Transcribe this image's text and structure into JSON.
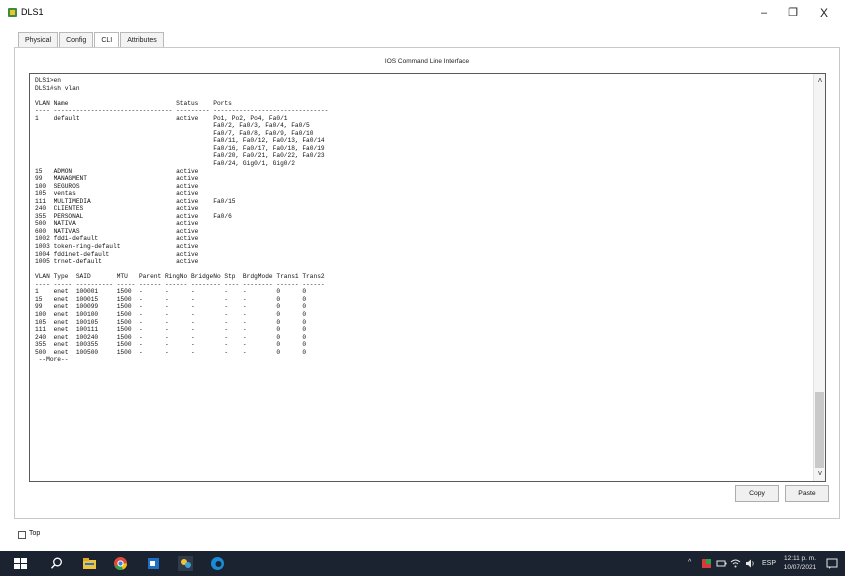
{
  "window": {
    "title": "DLS1",
    "minimize": "–",
    "maximize": "❐",
    "close": "X"
  },
  "tabs": [
    {
      "label": "Physical"
    },
    {
      "label": "Config"
    },
    {
      "label": "CLI"
    },
    {
      "label": "Attributes"
    }
  ],
  "frame_title": "IOS Command Line Interface",
  "terminal_text": "DLS1>en\nDLS1#sh vlan\n\nVLAN Name                             Status    Ports\n---- -------------------------------- --------- -------------------------------\n1    default                          active    Po1, Po2, Po4, Fa0/1\n                                                Fa0/2, Fa0/3, Fa0/4, Fa0/5\n                                                Fa0/7, Fa0/8, Fa0/9, Fa0/10\n                                                Fa0/11, Fa0/12, Fa0/13, Fa0/14\n                                                Fa0/16, Fa0/17, Fa0/18, Fa0/19\n                                                Fa0/20, Fa0/21, Fa0/22, Fa0/23\n                                                Fa0/24, Gig0/1, Gig0/2\n15   ADMON                            active\n99   MANAGMENT                        active\n100  SEGUROS                          active\n105  ventas                           active\n111  MULTIMEDIA                       active    Fa0/15\n240  CLIENTES                         active\n355  PERSONAL                         active    Fa0/6\n500  NATIVA                           active\n600  NATIVAS                          active\n1002 fddi-default                     active\n1003 token-ring-default               active\n1004 fddinet-default                  active\n1005 trnet-default                    active\n\nVLAN Type  SAID       MTU   Parent RingNo BridgeNo Stp  BrdgMode Trans1 Trans2\n---- ----- ---------- ----- ------ ------ -------- ---- -------- ------ ------\n1    enet  100001     1500  -      -      -        -    -        0      0\n15   enet  100015     1500  -      -      -        -    -        0      0\n99   enet  100099     1500  -      -      -        -    -        0      0\n100  enet  100100     1500  -      -      -        -    -        0      0\n105  enet  100105     1500  -      -      -        -    -        0      0\n111  enet  100111     1500  -      -      -        -    -        0      0\n240  enet  100240     1500  -      -      -        -    -        0      0\n355  enet  100355     1500  -      -      -        -    -        0      0\n500  enet  100500     1500  -      -      -        -    -        0      0\n --More--",
  "buttons": {
    "copy": "Copy",
    "paste": "Paste"
  },
  "top_checkbox": {
    "label": "Top",
    "checked": false
  },
  "taskbar": {
    "language": "ESP",
    "time": "12:11 p. m.",
    "date": "10/07/2021"
  }
}
